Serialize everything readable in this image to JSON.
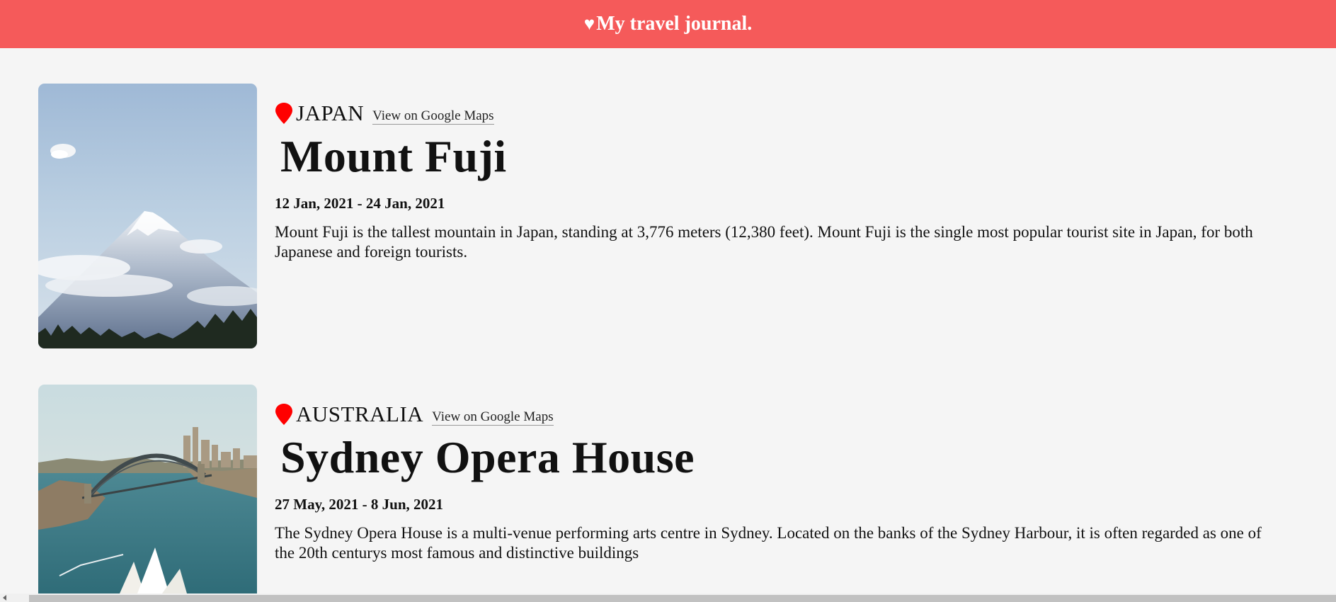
{
  "header": {
    "heart_icon": "♥",
    "title": "My travel journal."
  },
  "entries": [
    {
      "photo_icon": "mount-fuji-photo",
      "country": "JAPAN",
      "maps_link": "View on Google Maps",
      "title": "Mount Fuji",
      "dates": "12 Jan, 2021 - 24 Jan, 2021",
      "description": "Mount Fuji is the tallest mountain in Japan, standing at 3,776 meters (12,380 feet). Mount Fuji is the single most popular tourist site in Japan, for both Japanese and foreign tourists."
    },
    {
      "photo_icon": "sydney-harbour-photo",
      "country": "AUSTRALIA",
      "maps_link": "View on Google Maps",
      "title": "Sydney Opera House",
      "dates": "27 May, 2021 - 8 Jun, 2021",
      "description": "The Sydney Opera House is a multi-venue performing arts centre in Sydney. Located on the banks of the Sydney Harbour, it is often regarded as one of the 20th centurys most famous and distinctive buildings"
    }
  ],
  "colors": {
    "header_bg": "#f55a5a",
    "page_bg": "#f5f5f5",
    "pin": "#ff0000"
  }
}
